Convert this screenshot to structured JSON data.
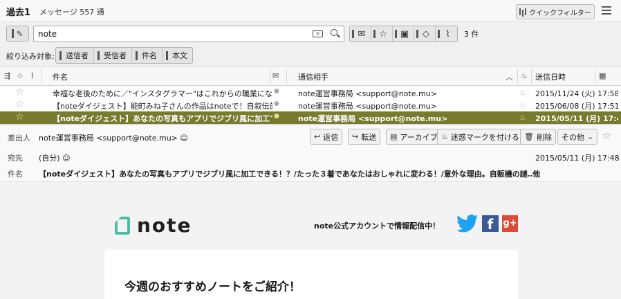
{
  "header": {
    "folder_name": "過去1",
    "message_count": "メッセージ 557 通",
    "quick_filter_label": "クイックフィルター"
  },
  "filter": {
    "search_value": "note",
    "result_count": "3 件",
    "narrow_label": "絞り込み対象:",
    "narrow_buttons": [
      "送信者",
      "受信者",
      "件名",
      "本文"
    ]
  },
  "columns": {
    "subject": "件名",
    "correspondent": "通信相手",
    "date": "送信日時"
  },
  "messages": [
    {
      "subject": "幸福な老後のために／\"インスタグラマー\"はこれからの職業になりえ...",
      "correspondent": "note運営事務局 <support@note.mu>",
      "date": "2015/11/24 (火) 17:58"
    },
    {
      "subject": "【noteダイジェスト】能町みね子さんの作品はnoteで！自叙伝的...",
      "correspondent": "note運営事務局 <support@note.mu>",
      "date": "2015/06/08 (月) 17:51"
    },
    {
      "subject": "【noteダイジェスト】あなたの写真もアプリでジブリ風に加工できる...",
      "correspondent": "note運営事務局 <support@note.mu>",
      "date": "2015/05/11 (月) 17:48"
    }
  ],
  "message_header": {
    "from_label": "差出人",
    "from_value": "note運営事務局 <support@note.mu>",
    "to_label": "宛先",
    "to_value": "(自分)",
    "subject_label": "件名",
    "subject_value": "【noteダイジェスト】あなたの写真もアプリでジブリ風に加工できる！？/たった３着であなたはおしゃれに変わる！/意外な理由。自販機の謎‥他",
    "date_value": "2015/05/11 (月) 17:48",
    "actions": {
      "reply": "返信",
      "forward": "転送",
      "archive": "アーカイブ",
      "junk": "迷惑マークを付ける",
      "delete": "削除",
      "other": "その他"
    }
  },
  "email": {
    "logo_text": "note",
    "promo_text": "note公式アカウントで情報配信中！",
    "gplus_text": "g+",
    "fb_text": "f",
    "card_title": "今週のおすすめノートをご紹介！"
  },
  "colors": {
    "selected_row": "#787a2e",
    "note_green": "#4dbba5",
    "facebook": "#3a5a97",
    "twitter": "#1da1f2",
    "gplus": "#dc4a38"
  }
}
